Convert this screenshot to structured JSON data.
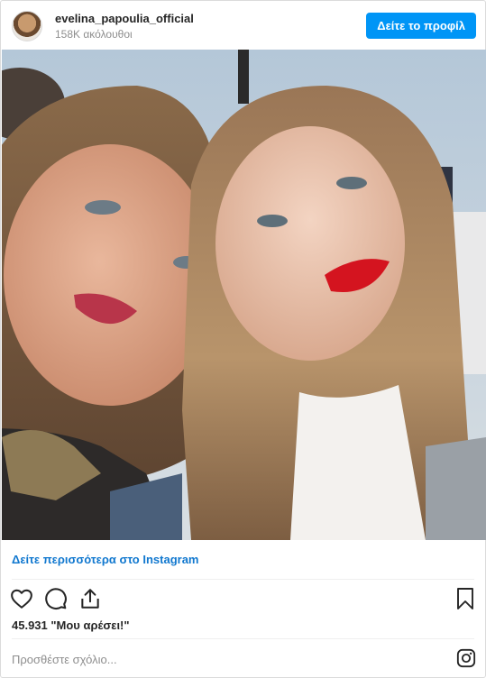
{
  "header": {
    "username": "evelina_papoulia_official",
    "followers": "158K ακόλουθοι",
    "profile_button": "Δείτε το προφίλ"
  },
  "post": {
    "view_more_link": "Δείτε περισσότερα στο Instagram",
    "likes": "45.931 \"Μου αρέσει!\"",
    "comment_placeholder": "Προσθέστε σχόλιο...",
    "icons": [
      "heart-icon",
      "comment-icon",
      "share-icon",
      "bookmark-icon",
      "instagram-icon"
    ]
  },
  "colors": {
    "accent": "#0095f6",
    "link": "#1178cf",
    "text": "#262626",
    "muted": "#8e8e8e"
  }
}
